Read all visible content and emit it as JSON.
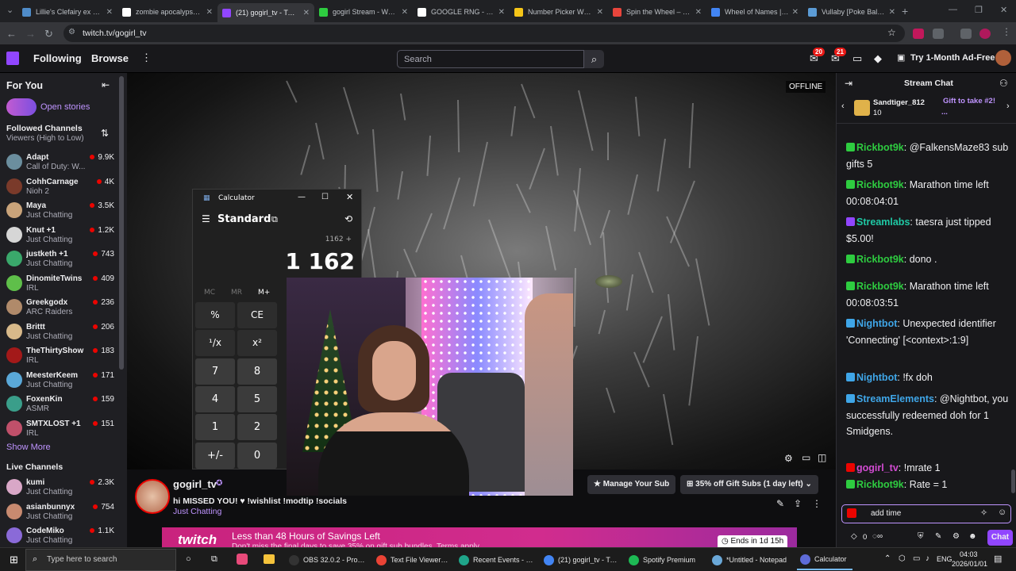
{
  "browser": {
    "tabs": [
      {
        "label": "Lillie's Clefairy ex #5...",
        "color": "#4f8cc9"
      },
      {
        "label": "zombie apocalypse fa...",
        "color": "#ffffff"
      },
      {
        "label": "(21) gogirl_tv - Twitch",
        "color": "#9146ff"
      },
      {
        "label": "gogirl Stream - Watc...",
        "color": "#2ecc40"
      },
      {
        "label": "GOOGLE RNG - Goo...",
        "color": "#ffffff"
      },
      {
        "label": "Number Picker Wheel...",
        "color": "#f5c518"
      },
      {
        "label": "Spin the Wheel – Free...",
        "color": "#e8453c"
      },
      {
        "label": "Wheel of Names | Ra...",
        "color": "#4285f4"
      },
      {
        "label": "Vullaby [Poke Ball] #...",
        "color": "#5b9bd5"
      }
    ],
    "url": "twitch.tv/gogirl_tv"
  },
  "twitch_nav": {
    "following": "Following",
    "browse": "Browse",
    "search_placeholder": "Search",
    "notif_badge_1": "20",
    "notif_badge_2": "21",
    "ad_free": "Try 1-Month Ad-Free"
  },
  "sidebar": {
    "for_you": "For You",
    "open_stories": "Open stories",
    "followed_title": "Followed Channels",
    "followed_sort": "Viewers (High to Low)",
    "followed": [
      {
        "name": "Adapt",
        "game": "Call of Duty: W...",
        "viewers": "9.9K",
        "color": "#6b8e9e"
      },
      {
        "name": "CohhCarnage",
        "game": "Nioh 2",
        "viewers": "4K",
        "color": "#7a3a2a"
      },
      {
        "name": "Maya",
        "game": "Just Chatting",
        "viewers": "3.5K",
        "color": "#c9a37a"
      },
      {
        "name": "Knut +1",
        "game": "Just Chatting",
        "viewers": "1.2K",
        "color": "#d6d6d6"
      },
      {
        "name": "justketh +1",
        "game": "Just Chatting",
        "viewers": "743",
        "color": "#3aa86b"
      },
      {
        "name": "DinomiteTwins",
        "game": "IRL",
        "viewers": "409",
        "color": "#5fbf4a"
      },
      {
        "name": "Greekgodx",
        "game": "ARC Raiders",
        "viewers": "236",
        "color": "#b08a6a"
      },
      {
        "name": "Brittt",
        "game": "Just Chatting",
        "viewers": "206",
        "color": "#d8b98a"
      },
      {
        "name": "TheThirtyShow",
        "game": "IRL",
        "viewers": "183",
        "color": "#a31919"
      },
      {
        "name": "MeesterKeem",
        "game": "Just Chatting",
        "viewers": "171",
        "color": "#5aa8d8"
      },
      {
        "name": "FoxenKin",
        "game": "ASMR",
        "viewers": "159",
        "color": "#3a9e8a"
      },
      {
        "name": "SMTXLOST +1",
        "game": "IRL",
        "viewers": "151",
        "color": "#c0506a"
      }
    ],
    "show_more": "Show More",
    "live_title": "Live Channels",
    "live": [
      {
        "name": "kumi",
        "game": "Just Chatting",
        "viewers": "2.3K",
        "color": "#d9a7c7"
      },
      {
        "name": "asianbunnyx",
        "game": "Just Chatting",
        "viewers": "754",
        "color": "#c88a70"
      },
      {
        "name": "CodeMiko",
        "game": "Just Chatting",
        "viewers": "1.1K",
        "color": "#8a6ad8"
      }
    ]
  },
  "video": {
    "offline": "OFFLINE"
  },
  "calculator": {
    "title": "Calculator",
    "mode": "Standard",
    "expression": "1162 +",
    "display": "1 162",
    "memory": [
      "MC",
      "MR",
      "M+"
    ],
    "buttons": [
      "%",
      "CE",
      "¹/x",
      "x²",
      "7",
      "8",
      "4",
      "5",
      "1",
      "2",
      "+/-",
      "0"
    ]
  },
  "channel": {
    "name": "gogirl_tv",
    "title": "hi MISSED YOU! ♥ !wishlist !modtip !socials",
    "category": "Just Chatting",
    "manage_sub": "Manage Your Sub",
    "gift_subs": "35% off Gift Subs (1 day left)"
  },
  "banner": {
    "logo": "twitch",
    "headline": "Less than 48 Hours of Savings Left",
    "sub": "Don't miss the final days to save 35% on gift sub bundles. Terms apply.",
    "ends": "Ends in 1d 15h"
  },
  "chat": {
    "title": "Stream Chat",
    "gifter": "Sandtiger_812",
    "gifter_count": "10",
    "gift_promo": "Gift to take #2!",
    "gift_promo_sub": "...",
    "messages": [
      {
        "user": "Rickbot9k",
        "color": "#2ecc40",
        "text": ": @FalkensMaze83 sub gifts 5"
      },
      {
        "user": "Rickbot9k",
        "color": "#2ecc40",
        "text": ": Marathon time left 00:08:04:01"
      },
      {
        "user": "Streamlabs",
        "color": "#1fc9a5",
        "text": ": taesra just tipped $5.00!"
      },
      {
        "user": "Rickbot9k",
        "color": "#2ecc40",
        "text": ": dono ."
      },
      {
        "user": "Rickbot9k",
        "color": "#2ecc40",
        "text": ": Marathon time left 00:08:03:51"
      },
      {
        "user": "Nightbot",
        "color": "#3fa6e8",
        "text": ": Unexpected identifier 'Connecting' [<context>:1:9]"
      },
      {
        "user": "Nightbot",
        "color": "#3fa6e8",
        "text": ": !fx doh"
      },
      {
        "user": "StreamElements",
        "color": "#3fa6e8",
        "text": ": @Nightbot, you successfully redeemed doh for 1 Smidgens."
      },
      {
        "user": "gogirl_tv",
        "color": "#d14bd1",
        "text": ": !mrate 1"
      },
      {
        "user": "Rickbot9k",
        "color": "#2ecc40",
        "text": ": Rate = 1"
      }
    ],
    "input_value": "add time",
    "points": "0",
    "chat_button": "Chat"
  },
  "taskbar": {
    "search": "Type here to search",
    "apps": [
      {
        "label": "OBS 32.0.2 - Profile:...",
        "color": "#333333"
      },
      {
        "label": "Text File Viewer - G...",
        "color": "#ea4335"
      },
      {
        "label": "Recent Events - Go...",
        "color": "#1fa58a"
      },
      {
        "label": "(21) gogirl_tv - Twit...",
        "color": "#4285f4"
      },
      {
        "label": "Spotify Premium",
        "color": "#1db954"
      },
      {
        "label": "*Untitled - Notepad",
        "color": "#6aa8d8"
      },
      {
        "label": "Calculator",
        "color": "#5e6bd8"
      }
    ],
    "lang": "ENG",
    "time": "04:03",
    "date": "2026/01/01"
  }
}
